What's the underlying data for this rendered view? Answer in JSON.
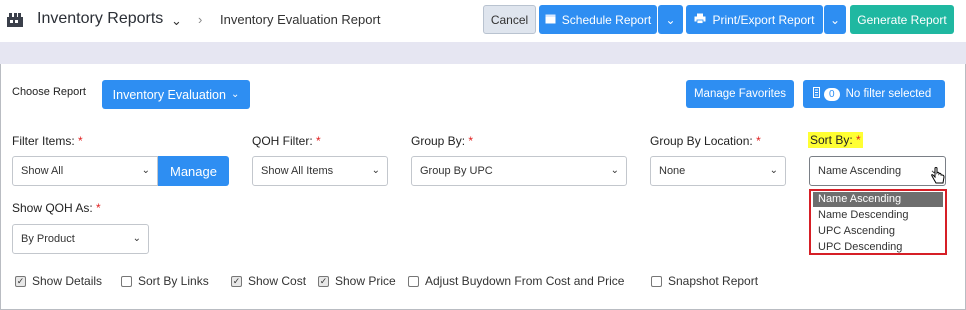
{
  "header": {
    "app_title": "Inventory Reports",
    "breadcrumb_current": "Inventory Evaluation Report",
    "cancel_label": "Cancel",
    "schedule_label": "Schedule Report",
    "print_label": "Print/Export Report",
    "generate_label": "Generate Report"
  },
  "toolbar": {
    "choose_label": "Choose Report",
    "report_selected": "Inventory Evaluation",
    "favorites_label": "Manage Favorites",
    "filter_count": "0",
    "filter_label": "No filter selected"
  },
  "filters": {
    "filter_items": {
      "label": "Filter Items:",
      "value": "Show All",
      "manage_label": "Manage"
    },
    "qoh_filter": {
      "label": "QOH Filter:",
      "value": "Show All Items"
    },
    "group_by": {
      "label": "Group By:",
      "value": "Group By UPC"
    },
    "group_by_location": {
      "label": "Group By Location:",
      "value": "None"
    },
    "sort_by": {
      "label": "Sort By:",
      "value": "Name Ascending"
    },
    "show_qoh_as": {
      "label": "Show QOH As:",
      "value": "By Product"
    },
    "required_mark": "*"
  },
  "sort_options": [
    "Name Ascending",
    "Name Descending",
    "UPC Ascending",
    "UPC Descending"
  ],
  "checkboxes": [
    {
      "label": "Show Details",
      "checked": true
    },
    {
      "label": "Sort By Links",
      "checked": false
    },
    {
      "label": "Show Cost",
      "checked": true
    },
    {
      "label": "Show Price",
      "checked": true
    },
    {
      "label": "Adjust Buydown From Cost and Price",
      "checked": false
    },
    {
      "label": "Snapshot Report",
      "checked": false
    }
  ],
  "colors": {
    "primary": "#2e8ef2",
    "generate": "#1fb8a1",
    "highlight": "#ffff33",
    "dropdown_border": "#d61f26"
  }
}
